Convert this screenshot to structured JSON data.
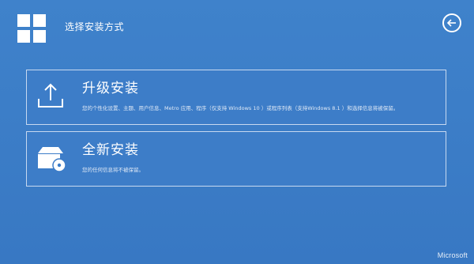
{
  "header": {
    "title": "选择安装方式",
    "back_icon": "back-arrow-icon",
    "logo_icon": "windows-logo-icon"
  },
  "options": [
    {
      "heading": "升级安装",
      "description": "您的个性化设置、主题、用户信息、Metro 应用、程序（仅支持 Windows 10 ）或程序列表（支持Windows 8.1 ）和选择信息将被保留。",
      "icon": "upload-tray-icon"
    },
    {
      "heading": "全新安装",
      "description": "您的任何信息将不被保留。",
      "icon": "box-disc-icon"
    }
  ],
  "footer": {
    "brand": "Microsoft"
  },
  "colors": {
    "background": "#3a7cc7",
    "card_border": "#c7d9f0",
    "text": "#ffffff"
  }
}
